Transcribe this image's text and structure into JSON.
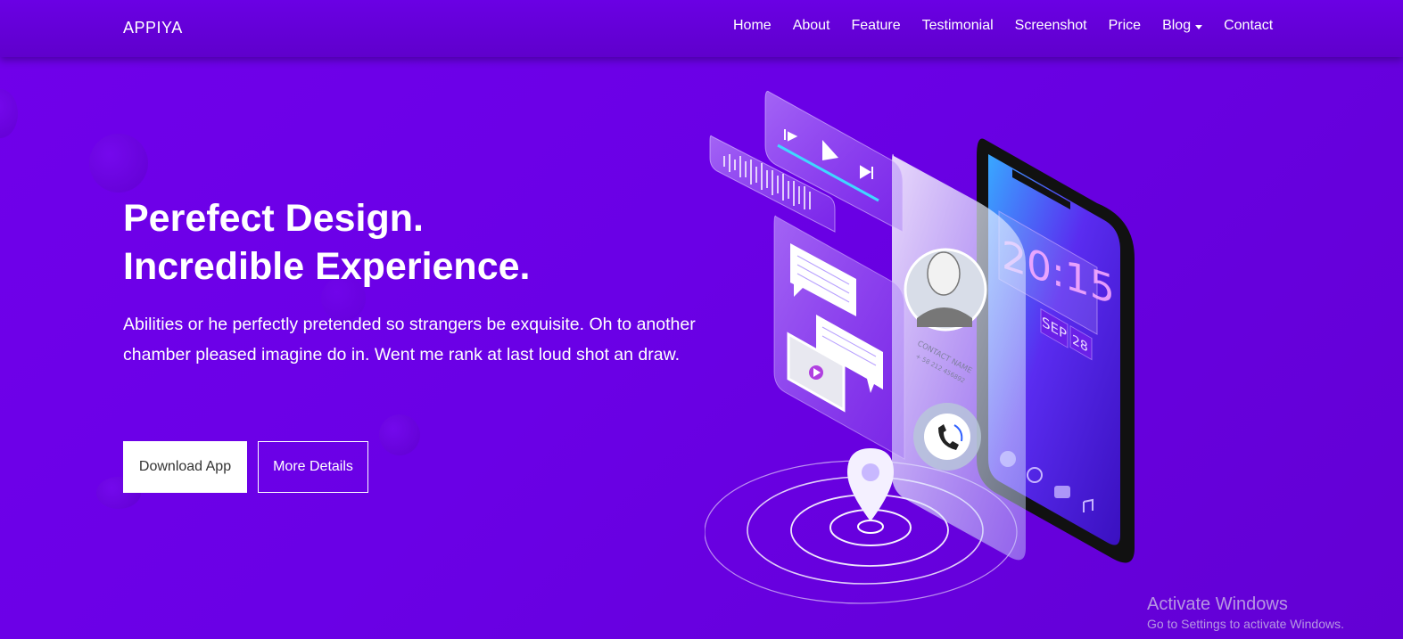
{
  "brand": "APPIYA",
  "nav": {
    "items": [
      "Home",
      "About",
      "Feature",
      "Testimonial",
      "Screenshot",
      "Price"
    ],
    "blog": "Blog",
    "contact": "Contact"
  },
  "hero": {
    "title_line1": "Perefect Design.",
    "title_line2": "Incredible Experience.",
    "text": "Abilities or he perfectly pretended so strangers be exquisite. Oh to another chamber pleased imagine do in. Went me rank at last loud shot an draw.",
    "download_label": "Download App",
    "details_label": "More Details"
  },
  "phone": {
    "time": "20:15",
    "month": "SEP",
    "day": "28",
    "contact_name": "CONTACT NAME",
    "contact_number": "+ 58 212 456892"
  },
  "watermark": {
    "title": "Activate Windows",
    "subtitle": "Go to Settings to activate Windows."
  },
  "colors": {
    "background": "#6b00e8",
    "navbar": "#6200d2",
    "button_bg": "#ffffff",
    "button_text": "#333333"
  },
  "icons": [
    "play-icon",
    "prev-icon",
    "next-icon",
    "audio-wave-icon",
    "chat-bubble-icon",
    "video-icon",
    "user-avatar-icon",
    "phone-call-icon",
    "location-pin-icon",
    "contacts-icon",
    "globe-icon",
    "camera-icon",
    "music-icon"
  ]
}
